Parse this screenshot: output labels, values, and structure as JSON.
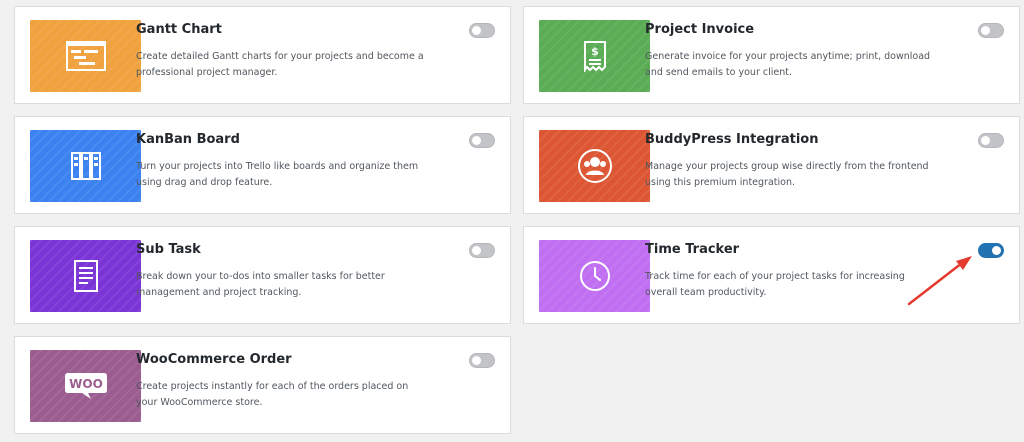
{
  "modules": [
    {
      "name": "Gantt Chart",
      "description": "Create detailed Gantt charts for your projects and become a professional project manager.",
      "icon": "gantt-chart-icon",
      "color": "#f0a23e",
      "enabled": false
    },
    {
      "name": "Project Invoice",
      "description": "Generate invoice for your projects anytime; print, download and send emails to your client.",
      "icon": "invoice-dollar-icon",
      "color": "#5aac55",
      "enabled": false
    },
    {
      "name": "KanBan Board",
      "description": "Turn your projects into Trello like boards and organize them using drag and drop feature.",
      "icon": "kanban-columns-icon",
      "color": "#3b82f0",
      "enabled": false
    },
    {
      "name": "BuddyPress Integration",
      "description": "Manage your projects group wise directly from the frontend using this premium integration.",
      "icon": "group-users-icon",
      "color": "#dd5633",
      "enabled": false
    },
    {
      "name": "Sub Task",
      "description": "Break down your to-dos into smaller tasks for better management and project tracking.",
      "icon": "document-list-icon",
      "color": "#7b35d6",
      "enabled": false
    },
    {
      "name": "Time Tracker",
      "description": "Track time for each of your project tasks for increasing overall team productivity.",
      "icon": "clock-icon",
      "color": "#c06ff2",
      "enabled": true
    },
    {
      "name": "WooCommerce Order",
      "description": "Create projects instantly for each of the orders placed on your WooCommerce store.",
      "icon": "woo-logo-icon",
      "color": "#9b5c8f",
      "enabled": false
    }
  ],
  "annotation": {
    "arrow_color": "#e53b2f"
  },
  "logo": {
    "woo_text": "WOO"
  }
}
